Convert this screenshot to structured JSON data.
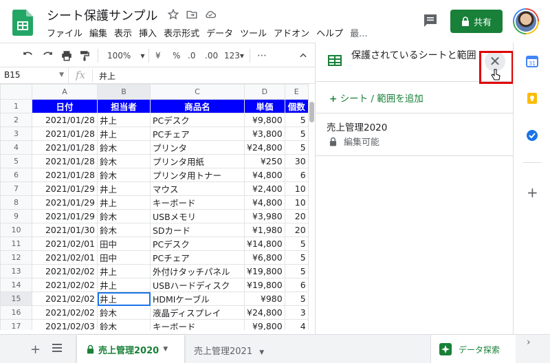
{
  "doc": {
    "title": "シート保護サンプル"
  },
  "menu": [
    "ファイル",
    "編集",
    "表示",
    "挿入",
    "表示形式",
    "データ",
    "ツール",
    "アドオン",
    "ヘルプ",
    "最..."
  ],
  "share_label": "共有",
  "toolbar": {
    "zoom": "100%",
    "currency": "¥",
    "percent": "%",
    "dec_decrease": ".0",
    "dec_increase": ".00",
    "format_more": "123▾",
    "more": "⋯"
  },
  "formula": {
    "cell_ref": "B15",
    "fx": "fx",
    "value": "井上"
  },
  "columns": [
    "A",
    "B",
    "C",
    "D",
    "E"
  ],
  "header_row": [
    "日付",
    "担当者",
    "商品名",
    "単価",
    "個数"
  ],
  "rows": [
    [
      "2021/01/28",
      "井上",
      "PCデスク",
      "¥9,800",
      "5"
    ],
    [
      "2021/01/28",
      "井上",
      "PCチェア",
      "¥3,800",
      "5"
    ],
    [
      "2021/01/28",
      "鈴木",
      "プリンタ",
      "¥24,800",
      "5"
    ],
    [
      "2021/01/28",
      "鈴木",
      "プリンタ用紙",
      "¥250",
      "30"
    ],
    [
      "2021/01/28",
      "鈴木",
      "プリンタ用トナー",
      "¥4,800",
      "6"
    ],
    [
      "2021/01/29",
      "井上",
      "マウス",
      "¥2,400",
      "10"
    ],
    [
      "2021/01/29",
      "井上",
      "キーボード",
      "¥4,800",
      "10"
    ],
    [
      "2021/01/29",
      "鈴木",
      "USBメモリ",
      "¥3,980",
      "20"
    ],
    [
      "2021/01/30",
      "鈴木",
      "SDカード",
      "¥1,980",
      "20"
    ],
    [
      "2021/02/01",
      "田中",
      "PCデスク",
      "¥14,800",
      "5"
    ],
    [
      "2021/02/01",
      "田中",
      "PCチェア",
      "¥6,800",
      "5"
    ],
    [
      "2021/02/02",
      "井上",
      "外付けタッチパネル",
      "¥19,800",
      "5"
    ],
    [
      "2021/02/02",
      "井上",
      "USBハードディスク",
      "¥19,800",
      "6"
    ],
    [
      "2021/02/02",
      "井上",
      "HDMIケーブル",
      "¥980",
      "5"
    ],
    [
      "2021/02/02",
      "鈴木",
      "液晶ディスプレイ",
      "¥24,800",
      "3"
    ],
    [
      "2021/02/03",
      "鈴木",
      "キーボード",
      "¥9,800",
      "4"
    ]
  ],
  "selected_row": 15,
  "panel": {
    "title": "保護されているシートと範囲",
    "add_label": "シート / 範囲を追加",
    "range_name": "売上管理2020",
    "permission": "編集可能"
  },
  "tabs": {
    "active": "売上管理2020",
    "inactive": "売上管理2021"
  },
  "explore_label": "データ探索",
  "colors": {
    "green": "#188038",
    "header_blue": "#0000ff",
    "highlight_red": "#e00000"
  }
}
